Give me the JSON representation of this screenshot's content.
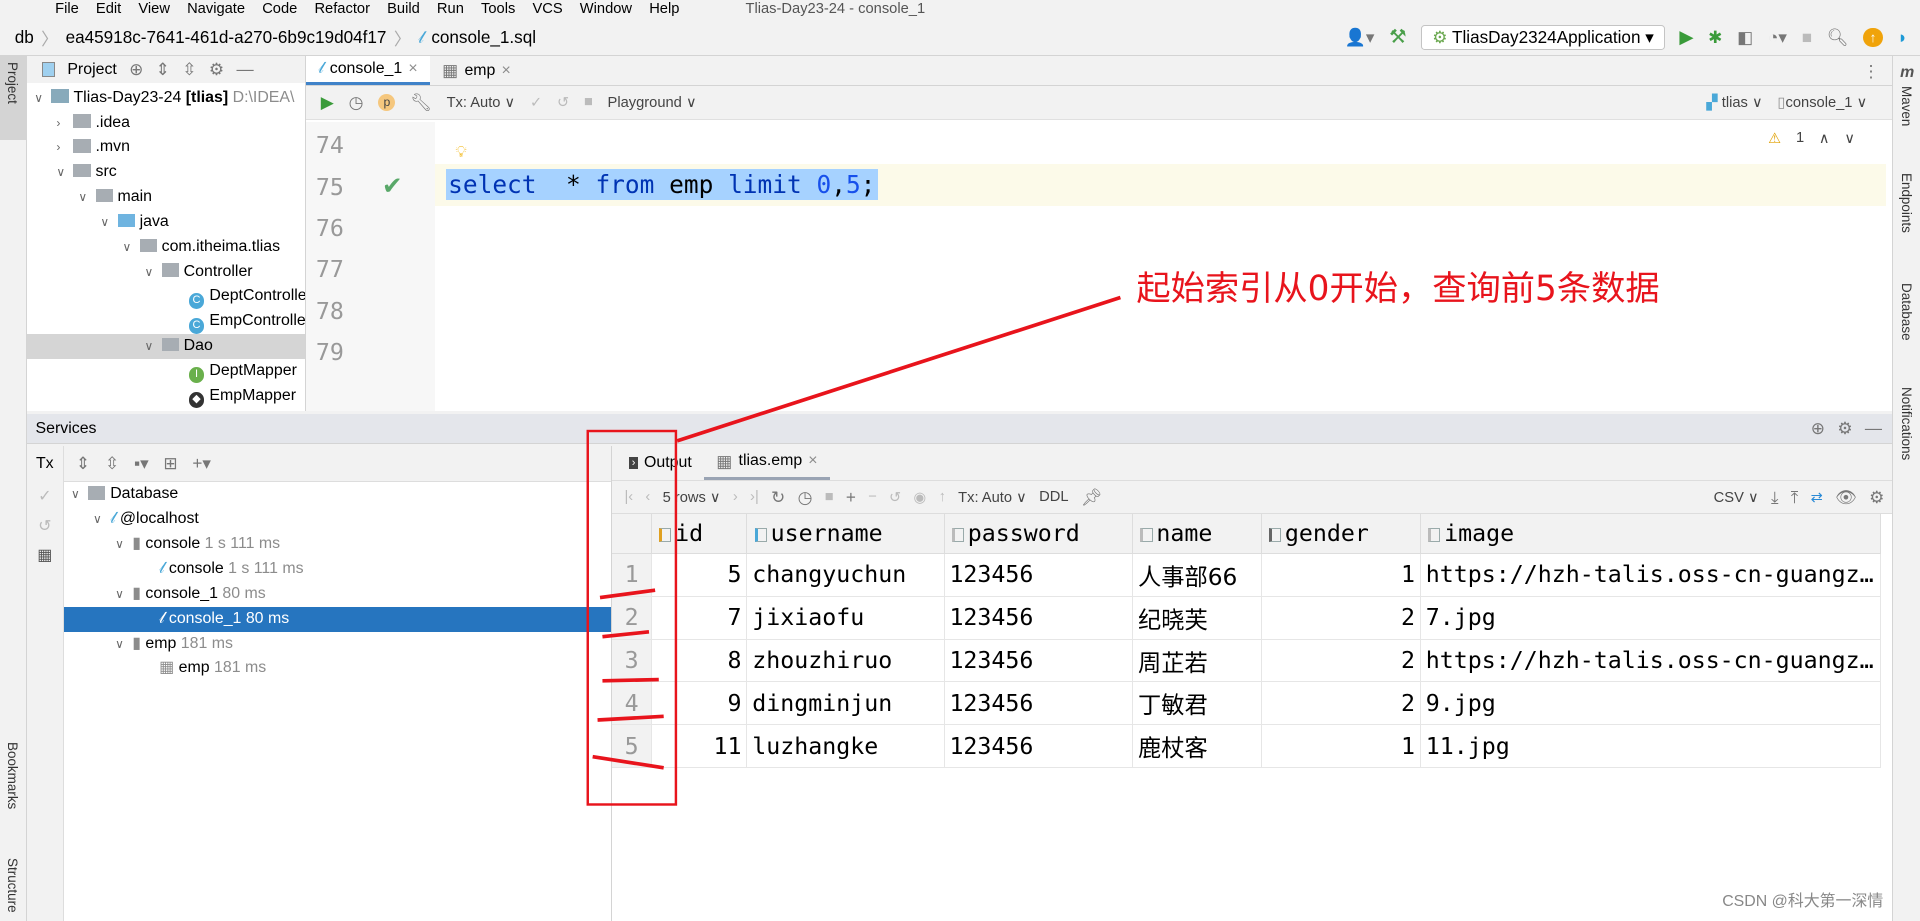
{
  "menu": [
    "File",
    "Edit",
    "View",
    "Navigate",
    "Code",
    "Refactor",
    "Build",
    "Run",
    "Tools",
    "VCS",
    "Window",
    "Help"
  ],
  "window_title": "Tlias-Day23-24 - console_1",
  "breadcrumb": [
    "db",
    "ea45918c-7641-461d-a270-6b9c19d04f17",
    "console_1.sql"
  ],
  "run_config": "TliasDay2324Application",
  "left_stripe": {
    "project": "Project",
    "bookmarks": "Bookmarks",
    "structure": "Structure"
  },
  "right_stripe": [
    "Maven",
    "Endpoints",
    "Database",
    "Notifications"
  ],
  "project": {
    "title": "Project",
    "tree": [
      {
        "label": "Tlias-Day23-24",
        "bold": "[tlias]",
        "path": "D:\\IDEA\\"
      },
      {
        "label": ".idea"
      },
      {
        "label": ".mvn"
      },
      {
        "label": "src"
      },
      {
        "label": "main"
      },
      {
        "label": "java"
      },
      {
        "label": "com.itheima.tlias"
      },
      {
        "label": "Controller"
      },
      {
        "label": "DeptController"
      },
      {
        "label": "EmpController"
      },
      {
        "label": "Dao"
      },
      {
        "label": "DeptMapper"
      },
      {
        "label": "EmpMapper"
      }
    ]
  },
  "editor": {
    "tabs": [
      "console_1",
      "emp"
    ],
    "toolbar": {
      "tx": "Tx: Auto",
      "playground": "Playground",
      "schema": "tlias",
      "session": "console_1",
      "warnings": "1"
    },
    "lines": [
      "74",
      "75",
      "76",
      "77",
      "78",
      "79"
    ],
    "code": {
      "kw1": "select",
      "star": "*",
      "kw2": "from",
      "table": "emp",
      "kw3": "limit",
      "n1": "0",
      "comma": ",",
      "n2": "5",
      "semi": ";"
    }
  },
  "annotation": {
    "text": "起始索引从0开始，查询前5条数据",
    "color": "#e8141c"
  },
  "services": {
    "title": "Services",
    "tx": "Tx",
    "tree": [
      {
        "label": "Database"
      },
      {
        "label": "@localhost"
      },
      {
        "label": "console",
        "time": "1 s 111 ms"
      },
      {
        "label": "console",
        "time": "1 s 111 ms"
      },
      {
        "label": "console_1",
        "time": "80 ms"
      },
      {
        "label": "console_1",
        "time": "80 ms",
        "selected": true
      },
      {
        "label": "emp",
        "time": "181 ms"
      },
      {
        "label": "emp",
        "time": "181 ms"
      }
    ]
  },
  "results": {
    "tabs": [
      "Output",
      "tlias.emp"
    ],
    "rows_label": "5 rows",
    "tx": "Tx: Auto",
    "ddl": "DDL",
    "csv": "CSV",
    "columns": [
      "id",
      "username",
      "password",
      "name",
      "gender",
      "image"
    ],
    "rows": [
      [
        "1",
        "5",
        "changyuchun",
        "123456",
        "人事部66",
        "1",
        "https://hzh-talis.oss-cn-guangzhou.aliyuncs.com/..."
      ],
      [
        "2",
        "7",
        "jixiaofu",
        "123456",
        "纪晓芙",
        "2",
        "7.jpg"
      ],
      [
        "3",
        "8",
        "zhouzhiruo",
        "123456",
        "周芷若",
        "2",
        "https://hzh-talis.oss-cn-guangzhou.aliyuncs.com/..."
      ],
      [
        "4",
        "9",
        "dingminjun",
        "123456",
        "丁敏君",
        "2",
        "9.jpg"
      ],
      [
        "5",
        "11",
        "luzhangke",
        "123456",
        "鹿杖客",
        "1",
        "11.jpg"
      ]
    ]
  },
  "watermark": "CSDN @科大第一深情"
}
